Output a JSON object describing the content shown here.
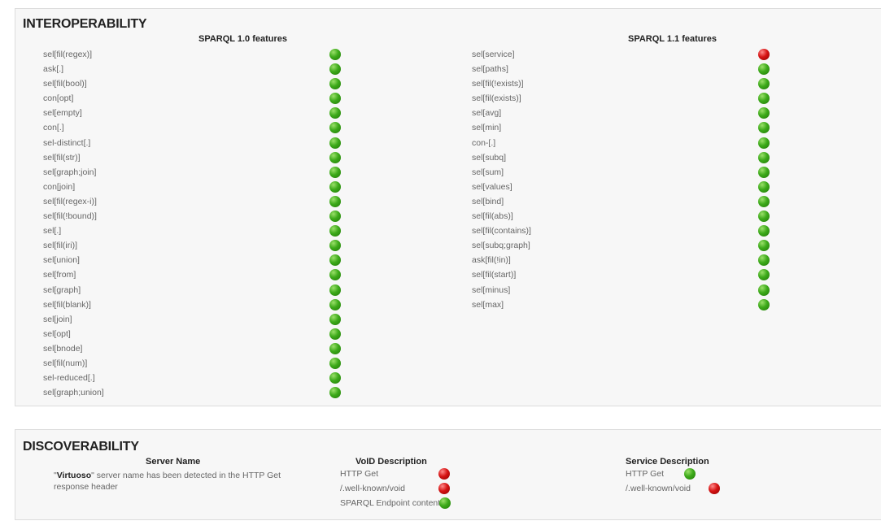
{
  "interoperability": {
    "title": "INTEROPERABILITY",
    "sparql10": {
      "heading": "SPARQL 1.0 features",
      "features": [
        {
          "label": "sel[fil(regex)]",
          "status": "ok"
        },
        {
          "label": "ask[.]",
          "status": "ok"
        },
        {
          "label": "sel[fil(bool)]",
          "status": "ok"
        },
        {
          "label": "con[opt]",
          "status": "ok"
        },
        {
          "label": "sel[empty]",
          "status": "ok"
        },
        {
          "label": "con[.]",
          "status": "ok"
        },
        {
          "label": "sel-distinct[.]",
          "status": "ok"
        },
        {
          "label": "sel[fil(str)]",
          "status": "ok"
        },
        {
          "label": "sel[graph;join]",
          "status": "ok"
        },
        {
          "label": "con[join]",
          "status": "ok"
        },
        {
          "label": "sel[fil(regex-i)]",
          "status": "ok"
        },
        {
          "label": "sel[fil(!bound)]",
          "status": "ok"
        },
        {
          "label": "sel[.]",
          "status": "ok"
        },
        {
          "label": "sel[fil(iri)]",
          "status": "ok"
        },
        {
          "label": "sel[union]",
          "status": "ok"
        },
        {
          "label": "sel[from]",
          "status": "ok"
        },
        {
          "label": "sel[graph]",
          "status": "ok"
        },
        {
          "label": "sel[fil(blank)]",
          "status": "ok"
        },
        {
          "label": "sel[join]",
          "status": "ok"
        },
        {
          "label": "sel[opt]",
          "status": "ok"
        },
        {
          "label": "sel[bnode]",
          "status": "ok"
        },
        {
          "label": "sel[fil(num)]",
          "status": "ok"
        },
        {
          "label": "sel-reduced[.]",
          "status": "ok"
        },
        {
          "label": "sel[graph;union]",
          "status": "ok"
        }
      ]
    },
    "sparql11": {
      "heading": "SPARQL 1.1 features",
      "features": [
        {
          "label": "sel[service]",
          "status": "fail"
        },
        {
          "label": "sel[paths]",
          "status": "ok"
        },
        {
          "label": "sel[fil(!exists)]",
          "status": "ok"
        },
        {
          "label": "sel[fil(exists)]",
          "status": "ok"
        },
        {
          "label": "sel[avg]",
          "status": "ok"
        },
        {
          "label": "sel[min]",
          "status": "ok"
        },
        {
          "label": "con-[.]",
          "status": "ok"
        },
        {
          "label": "sel[subq]",
          "status": "ok"
        },
        {
          "label": "sel[sum]",
          "status": "ok"
        },
        {
          "label": "sel[values]",
          "status": "ok"
        },
        {
          "label": "sel[bind]",
          "status": "ok"
        },
        {
          "label": "sel[fil(abs)]",
          "status": "ok"
        },
        {
          "label": "sel[fil(contains)]",
          "status": "ok"
        },
        {
          "label": "sel[subq;graph]",
          "status": "ok"
        },
        {
          "label": "ask[fil(!in)]",
          "status": "ok"
        },
        {
          "label": "sel[fil(start)]",
          "status": "ok"
        },
        {
          "label": "sel[minus]",
          "status": "ok"
        },
        {
          "label": "sel[max]",
          "status": "ok"
        }
      ]
    }
  },
  "discoverability": {
    "title": "DISCOVERABILITY",
    "server": {
      "heading": "Server Name",
      "name": "Virtuoso",
      "text": " server name has been detected in the HTTP Get response header"
    },
    "void": {
      "heading": "VoID Description",
      "items": [
        {
          "label": "HTTP Get",
          "status": "fail"
        },
        {
          "label": "/.well-known/void",
          "status": "fail"
        },
        {
          "label": "SPARQL Endpoint content",
          "status": "ok"
        }
      ]
    },
    "service": {
      "heading": "Service Description",
      "items": [
        {
          "label": "HTTP Get",
          "status": "ok"
        },
        {
          "label": "/.well-known/void",
          "status": "fail"
        }
      ]
    }
  },
  "colors": {
    "ok": "#3daa1a",
    "fail": "#d61414",
    "panel_bg": "#f7f7f7"
  }
}
